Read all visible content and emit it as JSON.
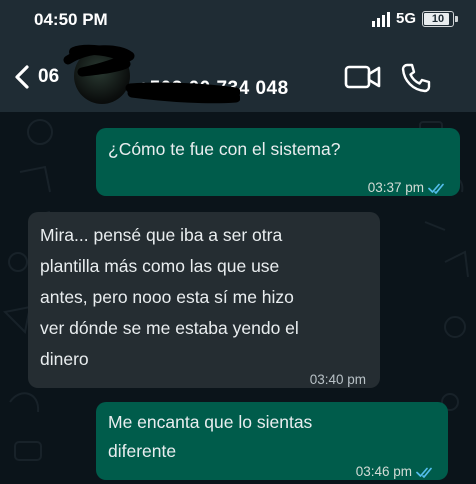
{
  "status_bar": {
    "time": "04:50 PM",
    "network": "5G",
    "battery": "10"
  },
  "header": {
    "contact_prefix": "06",
    "contact_name": "+503 00 734 048",
    "icons": [
      "back-arrow-icon",
      "video-call-icon",
      "phone-call-icon"
    ]
  },
  "messages": [
    {
      "direction": "outgoing",
      "lines": [
        "¿Cómo te fue con el sistema?"
      ],
      "time": "03:37 pm",
      "status": "read"
    },
    {
      "direction": "incoming",
      "lines": [
        "Mira... pensé que iba a ser otra",
        "plantilla más como las que use",
        "antes, pero nooo esta sí me hizo",
        "ver dónde se me estaba yendo el",
        "dinero"
      ],
      "time": "03:40 pm"
    },
    {
      "direction": "outgoing",
      "lines": [
        "Me encanta que lo sientas",
        "diferente"
      ],
      "time": "03:46 pm",
      "status": "read"
    }
  ],
  "colors": {
    "chat_background": "#0b141a",
    "bar_background": "#1f2c34",
    "outgoing_bubble": "#005c4b",
    "incoming_bubble": "#252d32",
    "read_ticks": "#53bdeb"
  }
}
